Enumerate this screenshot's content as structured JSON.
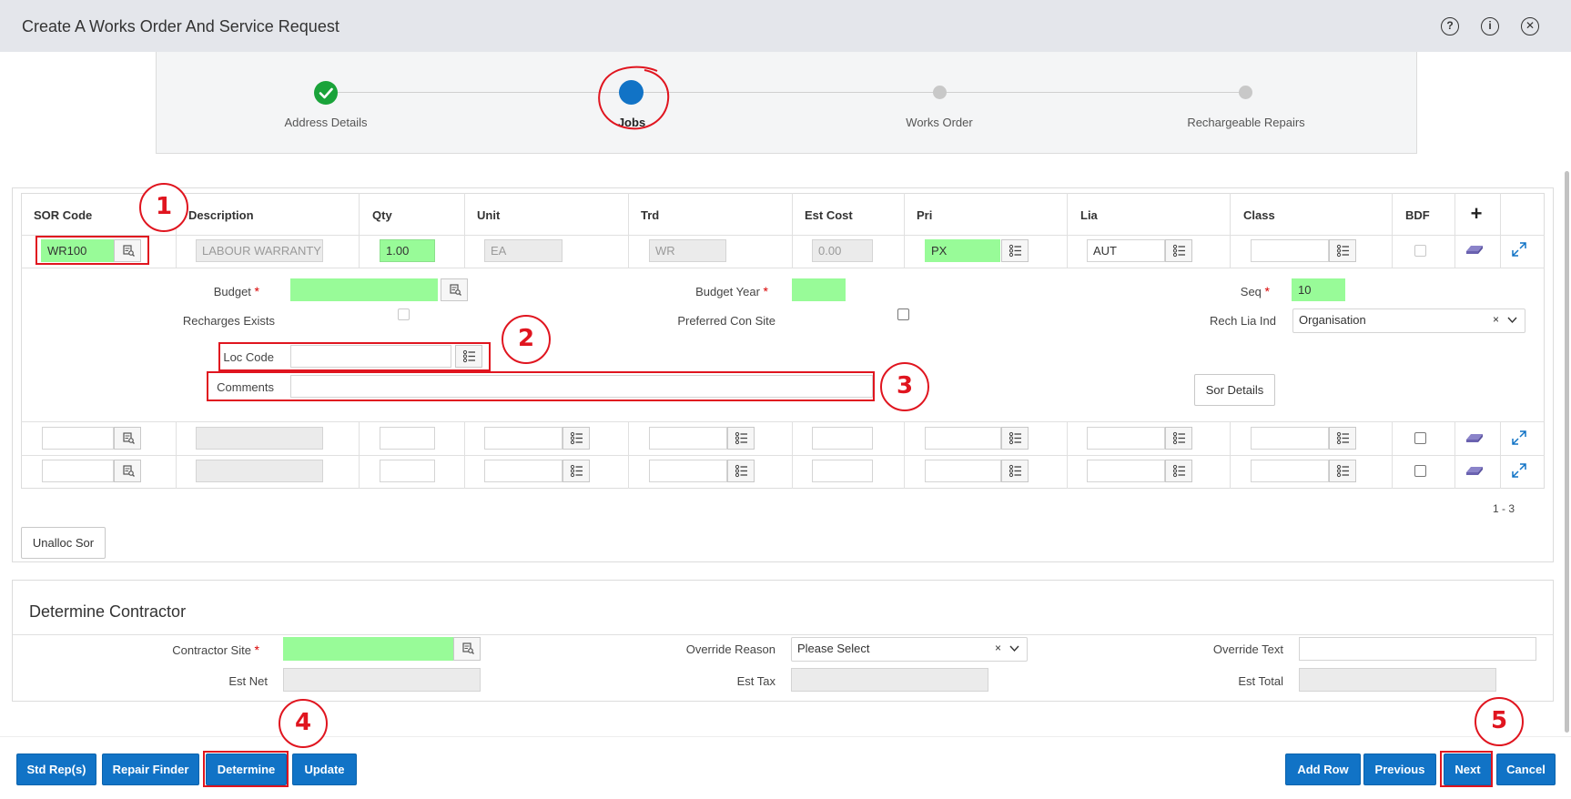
{
  "window": {
    "title": "Create A Works Order And Service Request",
    "help_icon": "question-circle-icon",
    "info_icon": "info-circle-icon",
    "close_icon": "close-circle-icon"
  },
  "wizard": {
    "steps": [
      {
        "label": "Address Details",
        "state": "complete"
      },
      {
        "label": "Jobs",
        "state": "current"
      },
      {
        "label": "Works Order",
        "state": "pending"
      },
      {
        "label": "Rechargeable Repairs",
        "state": "pending"
      }
    ]
  },
  "jobs_grid": {
    "columns": [
      "SOR Code",
      "Description",
      "Qty",
      "Unit",
      "Trd",
      "Est Cost",
      "Pri",
      "Lia",
      "Class",
      "BDF"
    ],
    "rows": [
      {
        "sor_code": "WR100",
        "description": "LABOUR WARRANTY I",
        "qty": "1.00",
        "unit": "EA",
        "trd": "WR",
        "est_cost": "0.00",
        "pri": "PX",
        "lia": "AUT",
        "class": "",
        "bdf": false
      },
      {
        "sor_code": "",
        "description": "",
        "qty": "",
        "unit": "",
        "trd": "",
        "est_cost": "",
        "pri": "",
        "lia": "",
        "class": "",
        "bdf": false
      },
      {
        "sor_code": "",
        "description": "",
        "qty": "",
        "unit": "",
        "trd": "",
        "est_cost": "",
        "pri": "",
        "lia": "",
        "class": "",
        "bdf": false
      }
    ],
    "pagination": "1 - 3",
    "detail": {
      "budget_label": "Budget",
      "budget_value": "",
      "budget_year_label": "Budget Year",
      "budget_year_value": "",
      "seq_label": "Seq",
      "seq_value": "10",
      "recharges_exists_label": "Recharges Exists",
      "recharges_exists_checked": false,
      "preferred_con_site_label": "Preferred Con Site",
      "preferred_con_site_checked": false,
      "rech_lia_ind_label": "Rech Lia Ind",
      "rech_lia_ind_value": "Organisation",
      "loc_code_label": "Loc Code",
      "loc_code_value": "",
      "comments_label": "Comments",
      "comments_value": "",
      "sor_details_label": "Sor Details"
    }
  },
  "unalloc_sor_label": "Unalloc Sor",
  "contractor": {
    "heading": "Determine Contractor",
    "contractor_site_label": "Contractor Site",
    "contractor_site_value": "",
    "override_reason_label": "Override Reason",
    "override_reason_value": "Please Select",
    "override_text_label": "Override Text",
    "override_text_value": "",
    "est_net_label": "Est Net",
    "est_net_value": "",
    "est_tax_label": "Est Tax",
    "est_tax_value": "",
    "est_total_label": "Est Total",
    "est_total_value": ""
  },
  "footer": {
    "std_reps": "Std Rep(s)",
    "repair_finder": "Repair Finder",
    "determine": "Determine",
    "update": "Update",
    "add_row": "Add Row",
    "previous": "Previous",
    "next": "Next",
    "cancel": "Cancel"
  },
  "callouts": [
    "1",
    "2",
    "3",
    "4",
    "5"
  ],
  "colors": {
    "primary_button": "#1173c6",
    "required_field": "#98fb98",
    "annotation_red": "#e0151f",
    "complete_step": "#1aa33a",
    "current_step": "#1173c6"
  }
}
